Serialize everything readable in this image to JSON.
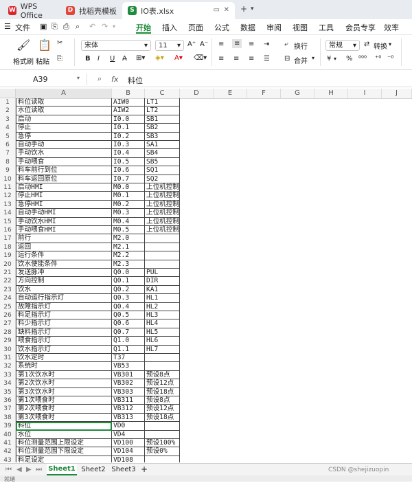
{
  "tabs": [
    {
      "label": "WPS Office",
      "icon": "wps-logo-icon"
    },
    {
      "label": "找稻壳模板",
      "icon": "docer-icon"
    },
    {
      "label": "IO表.xlsx",
      "icon": "spreadsheet-icon"
    }
  ],
  "menu": {
    "file_label": "文件",
    "items": [
      "开始",
      "插入",
      "页面",
      "公式",
      "数据",
      "审阅",
      "视图",
      "工具",
      "会员专享",
      "效率"
    ],
    "active": "开始"
  },
  "ribbon": {
    "format_painter": "格式刷",
    "paste": "粘贴",
    "font_name": "宋体",
    "font_size": "11",
    "wrap_text": "换行",
    "merge": "合并",
    "number_format": "常规",
    "convert": "转换",
    "currency": "¥",
    "percent": "%"
  },
  "formula_bar": {
    "cell_ref": "A39",
    "fx": "fx",
    "content": "料位"
  },
  "columns": [
    "A",
    "B",
    "C",
    "D",
    "E",
    "F",
    "G",
    "H",
    "I",
    "J"
  ],
  "rows": [
    [
      "料位读取",
      "AIW0",
      "LT1"
    ],
    [
      "水位读取",
      "AIW2",
      "LT2"
    ],
    [
      "启动",
      "I0.0",
      "SB1"
    ],
    [
      "停止",
      "I0.1",
      "SB2"
    ],
    [
      "急停",
      "I0.2",
      "SB3"
    ],
    [
      "自动手动",
      "I0.3",
      "SA1"
    ],
    [
      "手动饮水",
      "I0.4",
      "SB4"
    ],
    [
      "手动喂食",
      "I0.5",
      "SB5"
    ],
    [
      "料车前行到位",
      "I0.6",
      "SQ1"
    ],
    [
      "料车返回原位",
      "I0.7",
      "SQ2"
    ],
    [
      "启动HMI",
      "M0.0",
      "上位机控制"
    ],
    [
      "停止HMI",
      "M0.1",
      "上位机控制"
    ],
    [
      "急停HMI",
      "M0.2",
      "上位机控制"
    ],
    [
      "自动手动HMI",
      "M0.3",
      "上位机控制"
    ],
    [
      "手动饮水HMI",
      "M0.4",
      "上位机控制"
    ],
    [
      "手动喂食HMI",
      "M0.5",
      "上位机控制"
    ],
    [
      "前行",
      "M2.0",
      ""
    ],
    [
      "返回",
      "M2.1",
      ""
    ],
    [
      "运行条件",
      "M2.2",
      ""
    ],
    [
      "饮水使能条件",
      "M2.3",
      ""
    ],
    [
      "发送脉冲",
      "Q0.0",
      "PUL"
    ],
    [
      "方向控制",
      "Q0.1",
      "DIR"
    ],
    [
      "饮水",
      "Q0.2",
      "KA1"
    ],
    [
      "自动运行指示灯",
      "Q0.3",
      "HL1"
    ],
    [
      "故障指示灯",
      "Q0.4",
      "HL2"
    ],
    [
      "料足指示灯",
      "Q0.5",
      "HL3"
    ],
    [
      "料少指示灯",
      "Q0.6",
      "HL4"
    ],
    [
      "缺料指示灯",
      "Q0.7",
      "HL5"
    ],
    [
      "喂食指示灯",
      "Q1.0",
      "HL6"
    ],
    [
      "饮水指示灯",
      "Q1.1",
      "HL7"
    ],
    [
      "饮水定时",
      "T37",
      ""
    ],
    [
      "系统时",
      "VB53",
      ""
    ],
    [
      "第1次饮水时",
      "VB301",
      "预设8点"
    ],
    [
      "第2次饮水时",
      "VB302",
      "预设12点"
    ],
    [
      "第3次饮水时",
      "VB303",
      "预设18点"
    ],
    [
      "第1次喂食时",
      "VB311",
      "预设8点"
    ],
    [
      "第2次喂食时",
      "VB312",
      "预设12点"
    ],
    [
      "第3次喂食时",
      "VB313",
      "预设18点"
    ],
    [
      "料位",
      "VD0",
      ""
    ],
    [
      "水位",
      "VD4",
      ""
    ],
    [
      "料位测量范围上限设定",
      "VD100",
      "预设100%"
    ],
    [
      "料位测量范围下限设定",
      "VD104",
      "预设0%"
    ],
    [
      "料足设定",
      "VD108",
      ""
    ]
  ],
  "selected_row": 39,
  "sheets": [
    "Sheet1",
    "Sheet2",
    "Sheet3"
  ],
  "active_sheet": "Sheet1",
  "add_sheet": "+",
  "watermark": "CSDN @shejizuopin",
  "status_text": "就绪"
}
